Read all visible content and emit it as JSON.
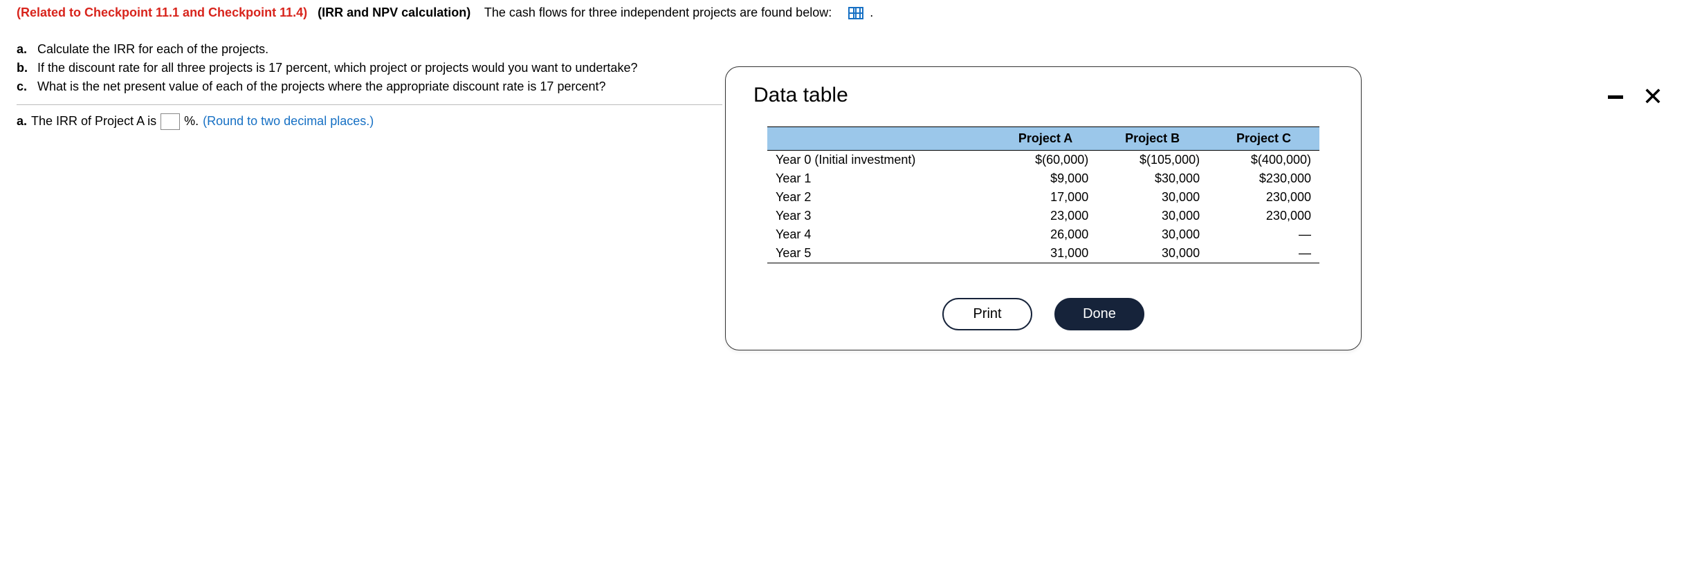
{
  "intro": {
    "related": "(Related to Checkpoint 11.1 and Checkpoint 11.4)",
    "topic": "(IRR and NPV calculation)",
    "lead": "The cash flows for three independent projects are found below:",
    "period": "."
  },
  "questions": {
    "a": {
      "label": "a.",
      "text": "Calculate the IRR for each of the projects."
    },
    "b": {
      "label": "b.",
      "text": "If the discount rate for all three projects is 17 percent, which project or projects would you want to undertake?"
    },
    "c": {
      "label": "c.",
      "text": "What is the net present value of each of the projects where the appropriate discount rate is 17 percent?"
    }
  },
  "answer": {
    "label": "a.",
    "pre": "The IRR of Project A is",
    "post": "%.",
    "hint": "(Round to two decimal places.)"
  },
  "modal": {
    "title": "Data table",
    "headers": {
      "blank": "",
      "a": "Project A",
      "b": "Project B",
      "c": "Project C"
    },
    "rows": [
      {
        "label": "Year 0  (Initial investment)",
        "a": "$(60,000)",
        "b": "$(105,000)",
        "c": "$(400,000)"
      },
      {
        "label": "Year 1",
        "a": "$9,000",
        "b": "$30,000",
        "c": "$230,000"
      },
      {
        "label": "Year 2",
        "a": "17,000",
        "b": "30,000",
        "c": "230,000"
      },
      {
        "label": "Year 3",
        "a": "23,000",
        "b": "30,000",
        "c": "230,000"
      },
      {
        "label": "Year 4",
        "a": "26,000",
        "b": "30,000",
        "c": "—"
      },
      {
        "label": "Year 5",
        "a": "31,000",
        "b": "30,000",
        "c": "—"
      }
    ],
    "buttons": {
      "print": "Print",
      "done": "Done"
    }
  }
}
